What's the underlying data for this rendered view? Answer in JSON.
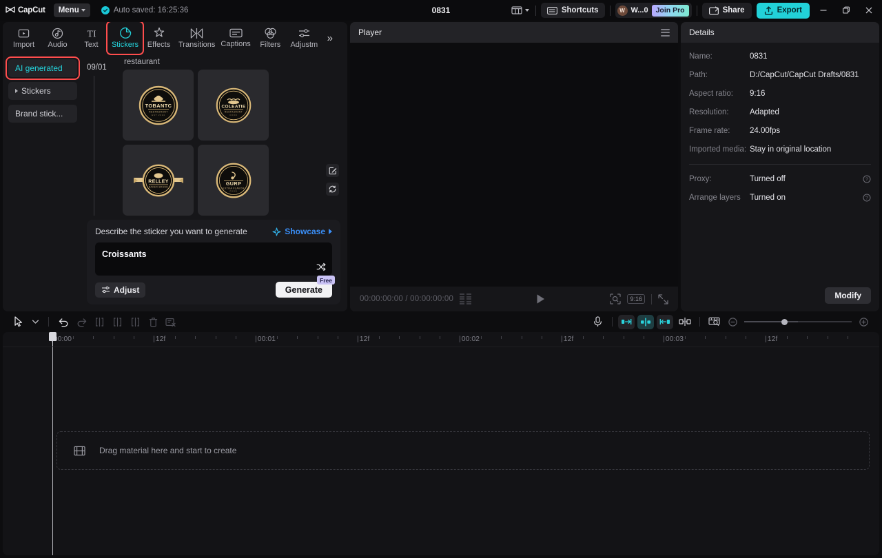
{
  "titlebar": {
    "brand": "CapCut",
    "menu_label": "Menu",
    "autosave_text": "Auto saved: 16:25:36",
    "project_title": "0831",
    "layout_icon": "layout-panels-icon",
    "shortcuts_label": "Shortcuts",
    "user_initial": "W",
    "user_name": "W...0",
    "join_pro_label": "Join Pro",
    "share_label": "Share",
    "export_label": "Export",
    "minimize_icon": "minimize-icon",
    "maximize_icon": "maximize-icon",
    "close_icon": "close-icon"
  },
  "toolbar": {
    "tabs": [
      {
        "label": "Import",
        "icon": "import-icon"
      },
      {
        "label": "Audio",
        "icon": "audio-icon"
      },
      {
        "label": "Text",
        "icon": "text-icon"
      },
      {
        "label": "Stickers",
        "icon": "sticker-icon"
      },
      {
        "label": "Effects",
        "icon": "effects-icon"
      },
      {
        "label": "Transitions",
        "icon": "transitions-icon"
      },
      {
        "label": "Captions",
        "icon": "captions-icon"
      },
      {
        "label": "Filters",
        "icon": "filters-icon"
      },
      {
        "label": "Adjustm",
        "icon": "adjustment-icon"
      }
    ],
    "active_tab": "Stickers",
    "more_label": "»",
    "highlight_color": "#ff4d4d",
    "active_color": "#24d4dd"
  },
  "library": {
    "categories": [
      {
        "label": "AI generated",
        "active": true,
        "expandable": false
      },
      {
        "label": "Stickers",
        "active": false,
        "expandable": true
      },
      {
        "label": "Brand stick...",
        "active": false,
        "expandable": false
      }
    ],
    "generated": {
      "date": "09/01",
      "set_name": "restaurant",
      "stickers": [
        {
          "name": "TOBANTC",
          "sub": "RESTAURANT",
          "style": "round"
        },
        {
          "name": "COLEATIE",
          "sub": "RESTAURANT",
          "style": "round"
        },
        {
          "name": "RELLEY",
          "sub": "BAKER BRAND",
          "style": "ribbon"
        },
        {
          "name": "GURP",
          "sub": "EXTRA FLAVOR",
          "style": "round"
        }
      ],
      "edit_icon": "edit-icon",
      "refresh_icon": "refresh-icon"
    },
    "prompt": {
      "title": "Describe the sticker you want to generate",
      "showcase_label": "Showcase",
      "value": "Croissants",
      "placeholder": "Describe the sticker you want to generate",
      "shuffle_icon": "shuffle-icon",
      "adjust_label": "Adjust",
      "generate_label": "Generate",
      "free_badge": "Free"
    }
  },
  "player": {
    "title": "Player",
    "menu_icon": "hamburger-icon",
    "current_time": "00:00:00:00",
    "total_time": "00:00:00:00",
    "timecode": "00:00:00:00 / 00:00:00:00",
    "play_icon": "play-icon",
    "zoom_icon": "magnify-icon",
    "aspect_ratio": "9:16",
    "fullscreen_icon": "fullscreen-icon"
  },
  "details": {
    "title": "Details",
    "fields": [
      {
        "label": "Name:",
        "value": "0831",
        "info": false
      },
      {
        "label": "Path:",
        "value": "D:/CapCut/CapCut Drafts/0831",
        "info": false
      },
      {
        "label": "Aspect ratio:",
        "value": "9:16",
        "info": false
      },
      {
        "label": "Resolution:",
        "value": "Adapted",
        "info": false
      },
      {
        "label": "Frame rate:",
        "value": "24.00fps",
        "info": false
      },
      {
        "label": "Imported media:",
        "value": "Stay in original location",
        "info": false
      }
    ],
    "fields2": [
      {
        "label": "Proxy:",
        "value": "Turned off",
        "info": true
      },
      {
        "label": "Arrange layers",
        "value": "Turned on",
        "info": true
      }
    ],
    "modify_label": "Modify"
  },
  "timeline": {
    "tools": [
      {
        "name": "select-tool",
        "icon": "cursor-icon"
      },
      {
        "name": "select-dropdown",
        "icon": "chevron-down-icon"
      },
      {
        "name": "undo",
        "icon": "undo-icon"
      },
      {
        "name": "redo",
        "icon": "redo-icon"
      },
      {
        "name": "split",
        "icon": "split-icon"
      },
      {
        "name": "trim-left",
        "icon": "trim-left-icon"
      },
      {
        "name": "trim-right",
        "icon": "trim-right-icon"
      },
      {
        "name": "delete",
        "icon": "trash-icon"
      },
      {
        "name": "clear",
        "icon": "clear-icon"
      }
    ],
    "right_tools": [
      {
        "name": "record",
        "icon": "microphone-icon"
      },
      {
        "name": "snap-start",
        "icon": "snap-left-icon"
      },
      {
        "name": "snap-center",
        "icon": "snap-center-icon"
      },
      {
        "name": "snap-end",
        "icon": "snap-right-icon"
      },
      {
        "name": "split-view",
        "icon": "split-view-icon"
      },
      {
        "name": "preview-panel",
        "icon": "preview-icon"
      }
    ],
    "zoom_out_icon": "zoom-out-icon",
    "zoom_in_icon": "zoom-in-icon",
    "ruler_labels": [
      "00:00",
      "12f",
      "00:01",
      "12f",
      "00:02",
      "12f",
      "00:03",
      "12f"
    ],
    "dropzone_text": "Drag material here and start to create",
    "dropzone_icon": "film-strip-icon",
    "playhead_time": "00:00"
  }
}
